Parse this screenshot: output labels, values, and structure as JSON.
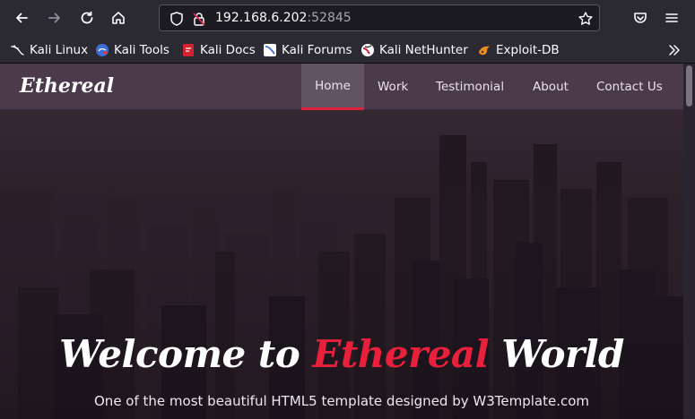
{
  "browser": {
    "url_host": "192.168.6.202",
    "url_port": ":52845",
    "icons": [
      "back-arrow-icon",
      "forward-arrow-icon",
      "reload-icon",
      "home-icon",
      "shield-icon",
      "insecure-lock-icon",
      "bookmark-star-icon",
      "pocket-icon",
      "menu-icon",
      "chevron-double-right-icon"
    ]
  },
  "bookmarks": [
    {
      "label": "Kali Linux",
      "icon": "kali-dragon-icon"
    },
    {
      "label": "Kali Tools",
      "icon": "kali-tools-icon"
    },
    {
      "label": "Kali Docs",
      "icon": "kali-docs-icon"
    },
    {
      "label": "Kali Forums",
      "icon": "kali-forums-icon"
    },
    {
      "label": "Kali NetHunter",
      "icon": "nethunter-icon"
    },
    {
      "label": "Exploit-DB",
      "icon": "exploit-db-icon"
    }
  ],
  "site": {
    "logo": "Ethereal",
    "nav": [
      {
        "label": "Home",
        "active": true
      },
      {
        "label": "Work",
        "active": false
      },
      {
        "label": "Testimonial",
        "active": false
      },
      {
        "label": "About",
        "active": false
      },
      {
        "label": "Contact Us",
        "active": false
      }
    ],
    "hero": {
      "title_before": "Welcome to ",
      "title_accent": "Ethereal",
      "title_after": " World",
      "subtitle": "One of the most beautiful HTML5 template designed by W3Template.com"
    }
  },
  "colors": {
    "accent": "#e8203c",
    "toolbar": "#2b2a33",
    "nav_bg": "#4d3c4e"
  }
}
